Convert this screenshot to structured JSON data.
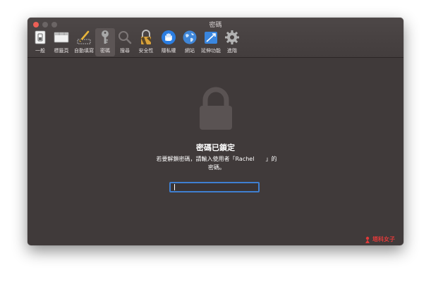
{
  "window": {
    "title": "密碼"
  },
  "toolbar": {
    "items": [
      {
        "label": "一般",
        "icon": "general-switch-icon"
      },
      {
        "label": "標籤頁",
        "icon": "tabs-icon"
      },
      {
        "label": "自動填寫",
        "icon": "autofill-pencil-icon"
      },
      {
        "label": "密碼",
        "icon": "key-icon",
        "active": true
      },
      {
        "label": "搜尋",
        "icon": "magnifier-icon"
      },
      {
        "label": "安全性",
        "icon": "security-lock-icon"
      },
      {
        "label": "隱私權",
        "icon": "privacy-hand-icon"
      },
      {
        "label": "網站",
        "icon": "globe-icon"
      },
      {
        "label": "延伸功能",
        "icon": "extensions-icon"
      },
      {
        "label": "進階",
        "icon": "gear-icon"
      }
    ]
  },
  "main": {
    "heading": "密碼已鎖定",
    "message_line1": "若要解鎖密碼，請輸入使用者「Rachel　　」的",
    "message_line2": "密碼。",
    "password_value": ""
  },
  "watermark": {
    "text": "塔科女子"
  },
  "colors": {
    "window_bg": "#403a3a",
    "focus_ring": "#3f7fd0",
    "close_button": "#ec5f56",
    "watermark": "#e03a3a"
  }
}
